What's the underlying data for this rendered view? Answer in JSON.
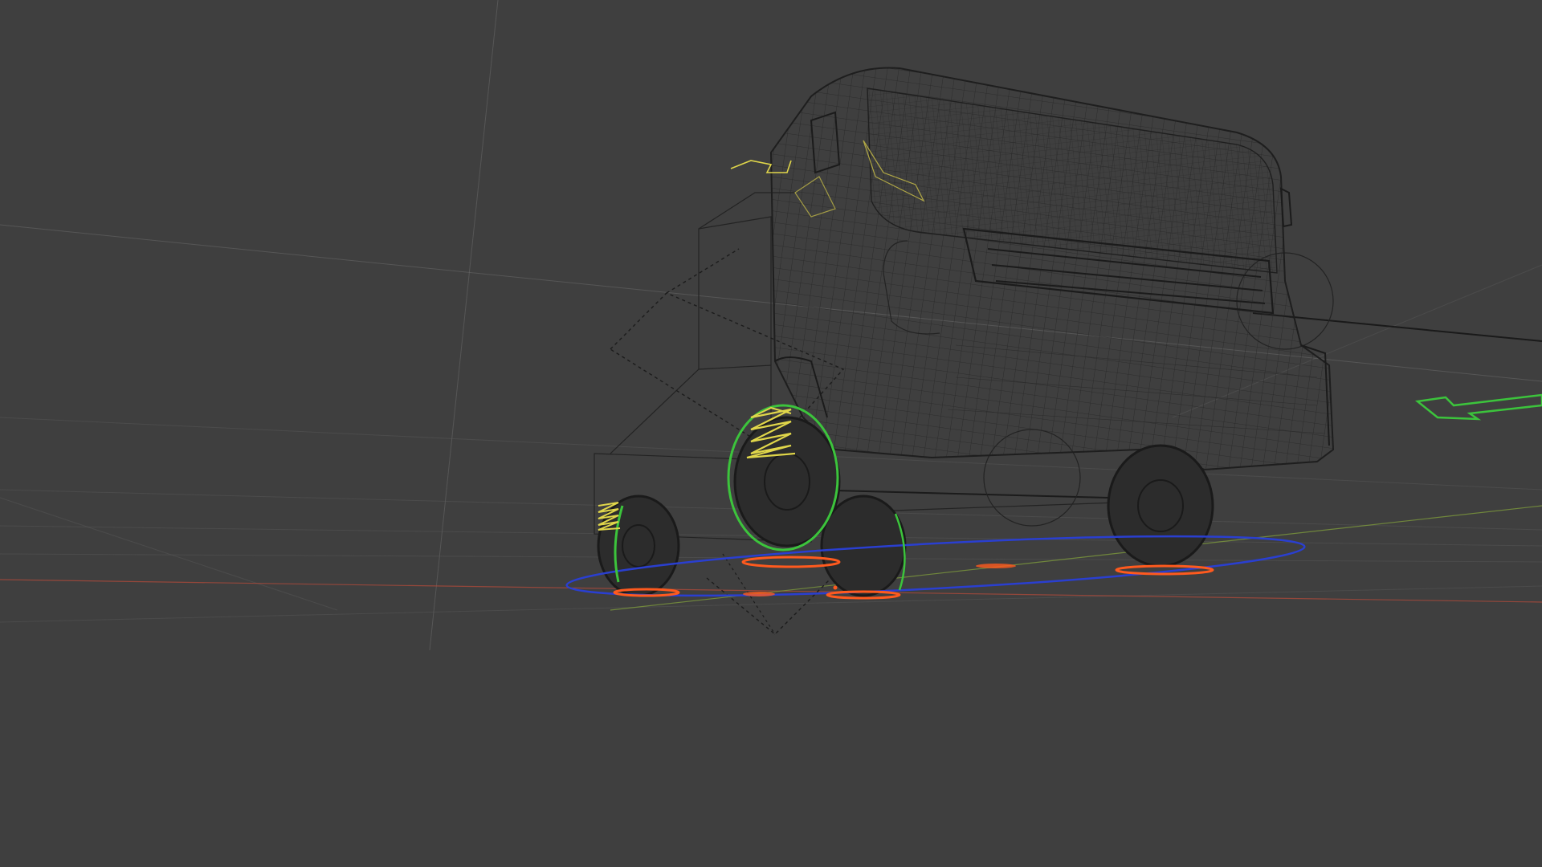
{
  "viewport": {
    "mode": "wireframe",
    "background": "#3f3f3f",
    "subject": "truck-cab-rig"
  },
  "colors": {
    "wireframe": "#232323",
    "grid": "#6a6a6a",
    "x_axis": "#b24a3a",
    "y_axis": "#7d9a3c",
    "spring_control": "#e0d64a",
    "wheel_control": "#3cc43c",
    "ground_contact": "#ff5a1e",
    "ground_circle": "#2a3fd0",
    "direction_arrow": "#3cc43c"
  },
  "icons": {
    "direction_arrow": "arrow-icon",
    "spring": "spring-icon",
    "top_arrow": "arrow-icon"
  }
}
